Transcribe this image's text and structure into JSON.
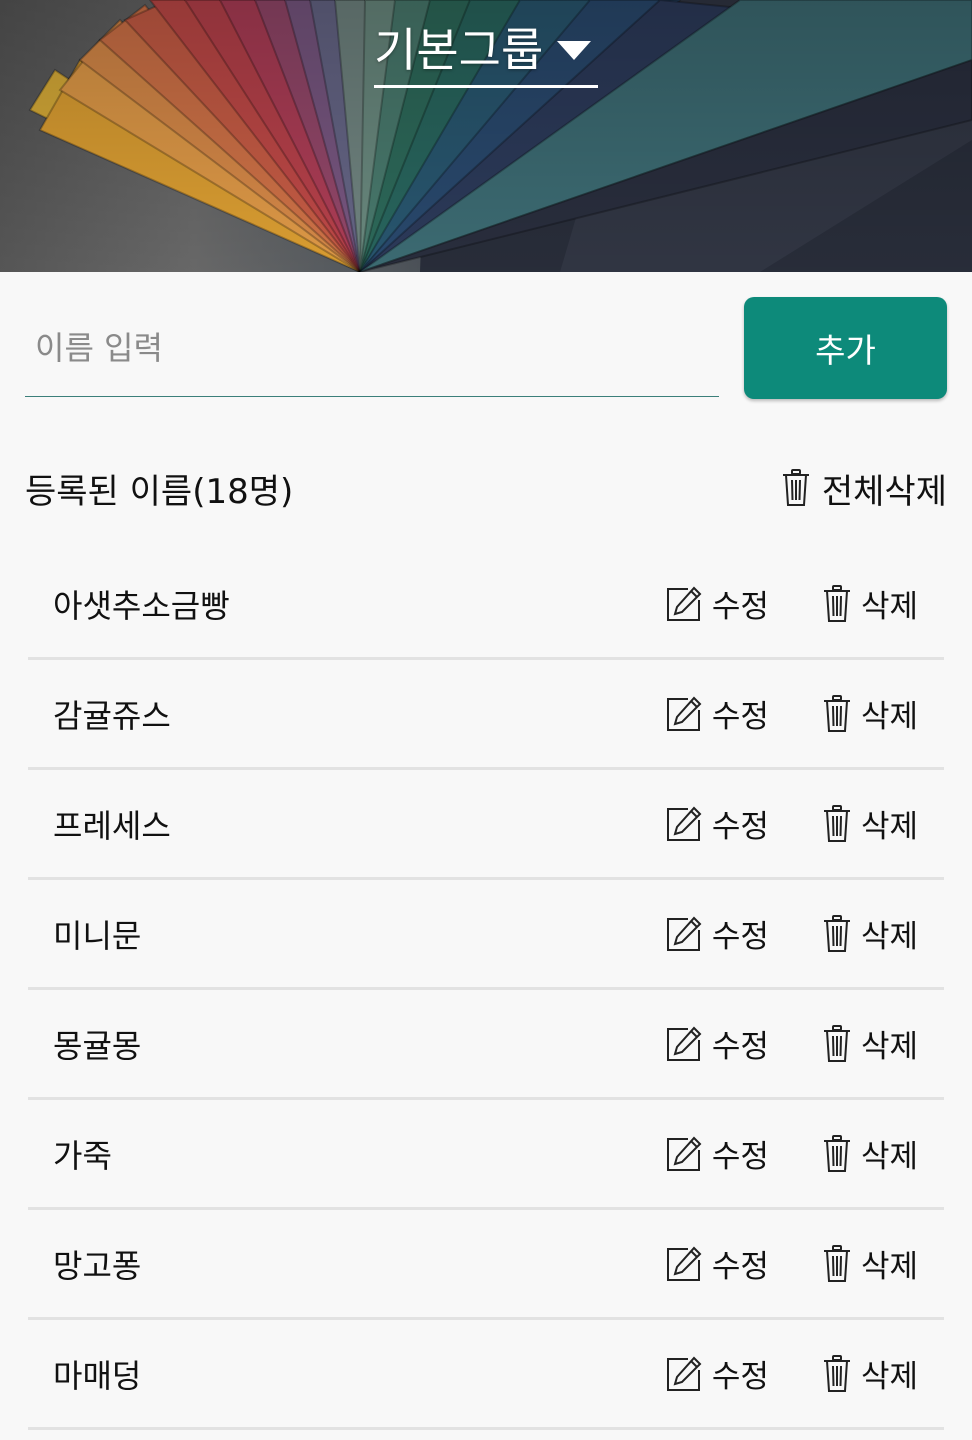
{
  "header": {
    "group_title": "기본그룹",
    "dropdown_icon": "caret-down-icon"
  },
  "input": {
    "placeholder": "이름 입력",
    "value": ""
  },
  "add_button_label": "추가",
  "list_header": {
    "count_label": "등록된 이름(18명)",
    "delete_all_label": "전체삭제",
    "delete_all_icon": "trash-icon"
  },
  "row_actions": {
    "edit_label": "수정",
    "edit_icon": "edit-icon",
    "delete_label": "삭제",
    "delete_icon": "trash-icon"
  },
  "names": [
    "아샛추소금빵",
    "감귤쥬스",
    "프레세스",
    "미니문",
    "몽귤몽",
    "가죽",
    "망고퐁",
    "마매덩"
  ],
  "colors": {
    "accent": "#0d8a7a",
    "divider": "#e2e2e2",
    "background": "#f8f8f8"
  }
}
